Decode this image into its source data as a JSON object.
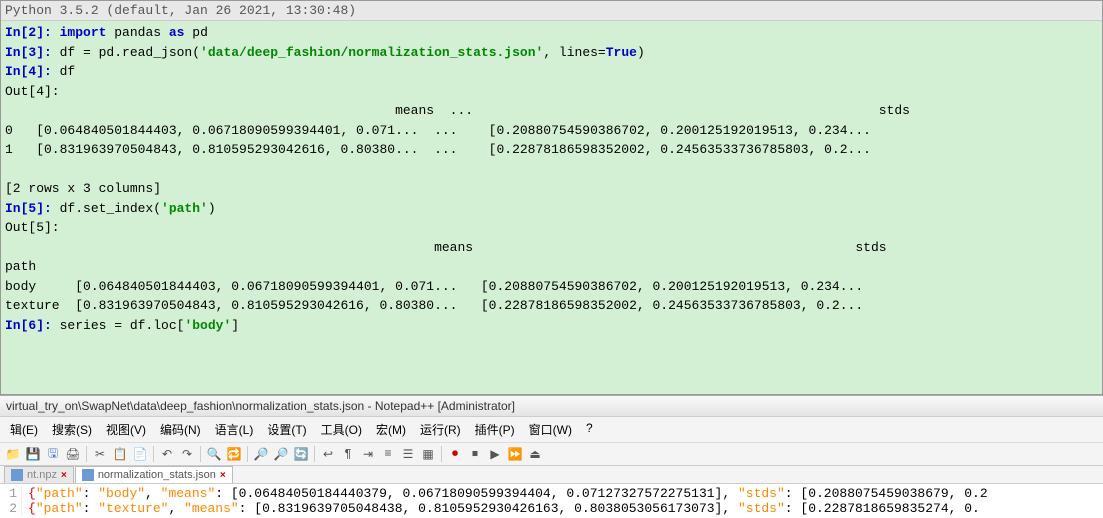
{
  "console": {
    "header": "Python 3.5.2 (default, Jan 26 2021, 13:30:48)",
    "prompts": {
      "in2": "In[2]:",
      "in3": "In[3]:",
      "in4": "In[4]:",
      "out4": "Out[4]:",
      "in5": "In[5]:",
      "out5": "Out[5]:",
      "in6": "In[6]:"
    },
    "code": {
      "line2_import": "import",
      "line2_pandas": " pandas ",
      "line2_as": "as",
      "line2_pd": " pd",
      "line3_pre": " df = pd.read_json(",
      "line3_str": "'data/deep_fashion/normalization_stats.json'",
      "line3_mid": ", lines=",
      "line3_true": "True",
      "line3_end": ")",
      "line4": " df",
      "line5_pre": " df.set_index(",
      "line5_str": "'path'",
      "line5_end": ")",
      "line6_pre": " series = df.loc[",
      "line6_str": "'body'",
      "line6_end": "]"
    },
    "output4": {
      "header": "                                                  means  ...                                                    stds",
      "row0": "0   [0.064840501844403, 0.06718090599394401, 0.071...  ...    [0.20880754590386702, 0.200125192019513, 0.234...",
      "row1": "1   [0.831963970504843, 0.810595293042616, 0.80380...  ...    [0.22878186598352002, 0.24563533736785803, 0.2...",
      "shape": "[2 rows x 3 columns]"
    },
    "output5": {
      "header": "                                                       means                                                 stds",
      "path": "path",
      "rowbody": "body     [0.064840501844403, 0.06718090599394401, 0.071...   [0.20880754590386702, 0.200125192019513, 0.234...",
      "rowtex": "texture  [0.831963970504843, 0.810595293042616, 0.80380...   [0.22878186598352002, 0.24563533736785803, 0.2..."
    }
  },
  "notepad": {
    "title": "virtual_try_on\\SwapNet\\data\\deep_fashion\\normalization_stats.json - Notepad++ [Administrator]",
    "menu": {
      "edit": "辑(E)",
      "search": "搜索(S)",
      "view": "视图(V)",
      "encoding": "编码(N)",
      "language": "语言(L)",
      "settings": "设置(T)",
      "tools": "工具(O)",
      "macro": "宏(M)",
      "run": "运行(R)",
      "plugins": "插件(P)",
      "window": "窗口(W)",
      "help": "?"
    },
    "tabs": {
      "tab1": "nt.npz",
      "tab2": "normalization_stats.json"
    },
    "content": {
      "line1_num": "1",
      "line2_num": "2",
      "line1": {
        "open": "{",
        "k_path": "\"path\"",
        "colon1": ": ",
        "v_path": "\"body\"",
        "comma1": ", ",
        "k_means": "\"means\"",
        "colon2": ": ",
        "v_means": "[0.06484050184440379, 0.06718090599394404, 0.07127327572275131]",
        "comma2": ", ",
        "k_stds": "\"stds\"",
        "colon3": ": ",
        "v_stds": "[0.2088075459038679, 0.2"
      },
      "line2": {
        "open": "{",
        "k_path": "\"path\"",
        "colon1": ": ",
        "v_path": "\"texture\"",
        "comma1": ", ",
        "k_means": "\"means\"",
        "colon2": ": ",
        "v_means": "[0.8319639705048438, 0.8105952930426163, 0.8038053056173073]",
        "comma2": ", ",
        "k_stds": "\"stds\"",
        "colon3": ": ",
        "v_stds": "[0.2287818659835274, 0."
      }
    }
  }
}
